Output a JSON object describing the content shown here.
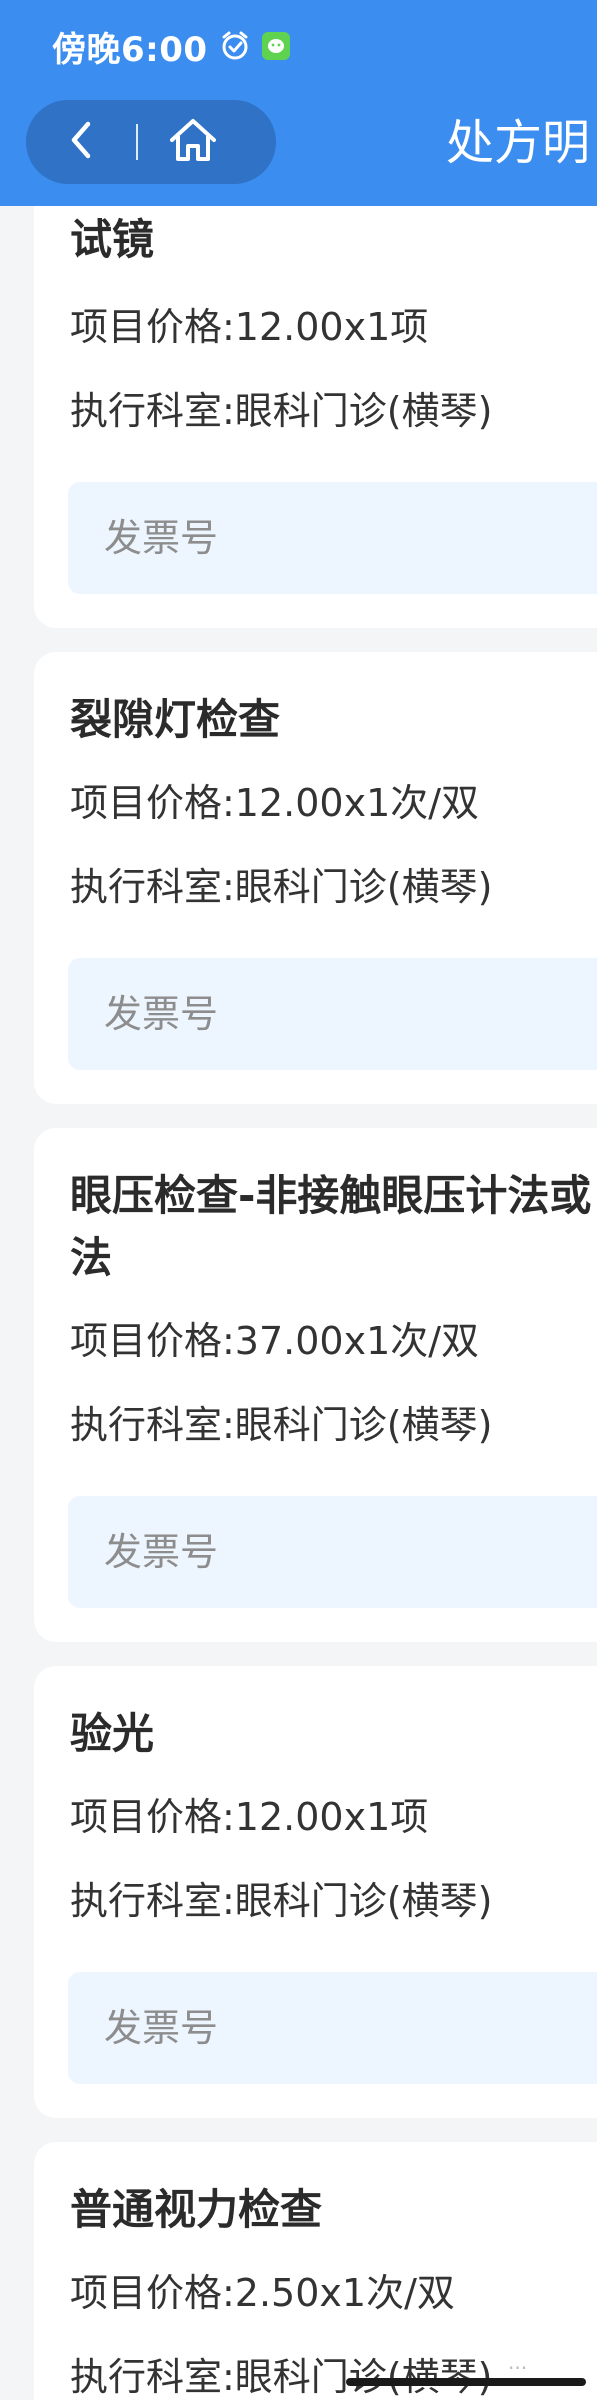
{
  "status_bar": {
    "time": "傍晚6:00",
    "icons": [
      "alarm-icon",
      "wechat-icon"
    ]
  },
  "header": {
    "title": "处方明",
    "back_icon": "back-chevron-icon",
    "home_icon": "home-icon",
    "background": "#3b8df0",
    "capsule_color": "#2f72c6"
  },
  "items": [
    {
      "name": "试镜",
      "price": "项目价格:12.00x1项",
      "dept": "执行科室:眼科门诊(横琴)",
      "invoice_placeholder": "发票号"
    },
    {
      "name": "裂隙灯检查",
      "price": "项目价格:12.00x1次/双",
      "dept": "执行科室:眼科门诊(横琴)",
      "invoice_placeholder": "发票号"
    },
    {
      "name": "眼压检查-非接触眼压计法或",
      "name_line2": "法",
      "price": "项目价格:37.00x1次/双",
      "dept": "执行科室:眼科门诊(横琴)",
      "invoice_placeholder": "发票号"
    },
    {
      "name": "验光",
      "price": "项目价格:12.00x1项",
      "dept": "执行科室:眼科门诊(横琴)",
      "invoice_placeholder": "发票号"
    },
    {
      "name": "普通视力检查",
      "price": "项目价格:2.50x1次/双",
      "dept": "执行科室:眼科门诊(横琴)"
    }
  ],
  "colors": {
    "invoice_bg": "#edf5ff",
    "page_bg": "#f4f5f7"
  }
}
